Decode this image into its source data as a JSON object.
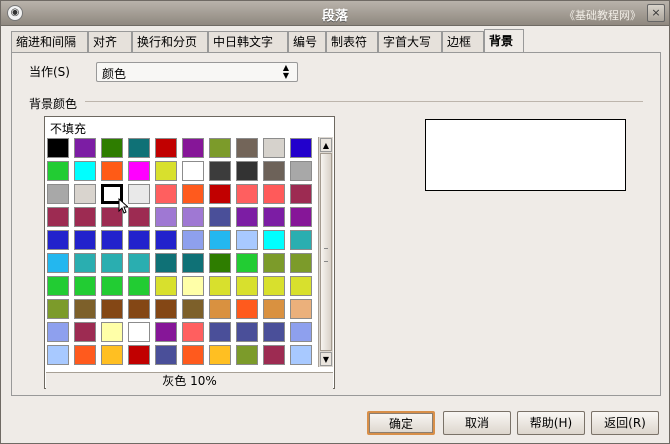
{
  "title": "段落",
  "watermark": "《基础教程网》",
  "tabs": [
    {
      "label": "缩进和间隔"
    },
    {
      "label": "对齐"
    },
    {
      "label": "换行和分页"
    },
    {
      "label": "中日韩文字"
    },
    {
      "label": "编号"
    },
    {
      "label": "制表符"
    },
    {
      "label": "字首大写"
    },
    {
      "label": "边框"
    },
    {
      "label": "背景"
    }
  ],
  "active_tab": "背景",
  "dropdown": {
    "label": "当作(S)",
    "value": "颜色"
  },
  "section": {
    "title": "背景颜色"
  },
  "palette": {
    "no_fill": "不填充",
    "status": "灰色 10%",
    "selected_index": 22,
    "colors": [
      "#000000",
      "#7c1da4",
      "#2e7d00",
      "#0f7176",
      "#c10000",
      "#861698",
      "#7c9b2a",
      "#736559",
      "#d6d2cc",
      "#2200cc",
      "#22cc33",
      "#00ffff",
      "#ff5b16",
      "#ff00ff",
      "#d8e02d",
      "#ffffff",
      "#3c3c3c",
      "#333333",
      "#6d6259",
      "#a8a8a8",
      "#a8a8a8",
      "#d9d4ce",
      "#ffffff",
      "#e9e9e9",
      "#ff5f5f",
      "#ff5a1d",
      "#c10000",
      "#ff5f5f",
      "#ff5a5a",
      "#9d2b52",
      "#9d2b52",
      "#9d2b52",
      "#9d2b52",
      "#9d2b52",
      "#9f78d3",
      "#9f78d3",
      "#4a4f99",
      "#7c1da4",
      "#7c1da4",
      "#861698",
      "#2222cc",
      "#2222cc",
      "#2222cc",
      "#2222cc",
      "#2222cc",
      "#8ea0ee",
      "#23b7ef",
      "#a8c9ff",
      "#00ffff",
      "#2aaeb0",
      "#23b7ef",
      "#2aaeb0",
      "#2aaeb0",
      "#2aaeb0",
      "#0f7176",
      "#0f7176",
      "#2e7d00",
      "#22cc33",
      "#7c9b2a",
      "#7c9b2a",
      "#22cc33",
      "#22cc33",
      "#22cc33",
      "#22cc33",
      "#d8e02d",
      "#ffffa8",
      "#d8e02d",
      "#d8e02d",
      "#d8e02d",
      "#d8e02d",
      "#7c9b2a",
      "#7d602a",
      "#844715",
      "#844715",
      "#844715",
      "#7d602a",
      "#d99140",
      "#ff5a1d",
      "#d99140",
      "#ebb07b",
      "#8ea0ee",
      "#9d2b52",
      "#ffffa8",
      "#ffffff",
      "#861698",
      "#ff5f5f",
      "#4a4f99",
      "#4a4f99",
      "#4a4f99",
      "#8ea0ee",
      "#a8c9ff",
      "#ff5a1d",
      "#ffbf22",
      "#c10000",
      "#4a4f99",
      "#ff5a1d",
      "#ffbf22",
      "#7c9b2a",
      "#9d2b52",
      "#a8c9ff"
    ]
  },
  "buttons": {
    "ok": "确定",
    "cancel": "取消",
    "help": "帮助(H)",
    "reset": "返回(R)"
  },
  "icons": {
    "window_menu": "window-menu-icon",
    "close": "close-icon",
    "spin_arrows": "spin-arrows-icon",
    "scroll_up": "scroll-up-arrow-icon",
    "scroll_down": "scroll-down-arrow-icon",
    "mouse_cursor": "mouse-pointer-icon"
  }
}
